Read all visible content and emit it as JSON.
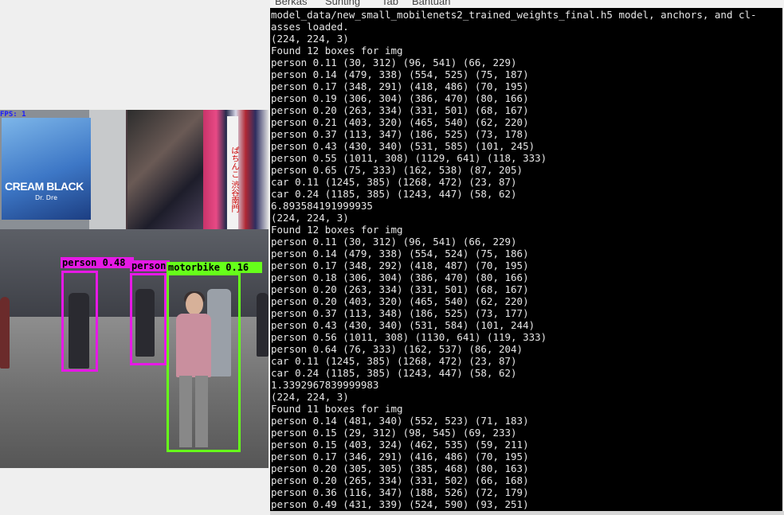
{
  "menubar": {
    "items": [
      "Berkas",
      "Sunting",
      "Tab",
      "Bantuan"
    ]
  },
  "detection_window": {
    "title_tag": "FPS: 1",
    "billboard_text": "CREAM BLACK",
    "billboard_sub": "Dr. Dre",
    "vertical_sign": "ぱちんこ 渋谷南門",
    "boxes": [
      {
        "label": "person 0.48",
        "color": "#e619e6"
      },
      {
        "label": "person",
        "color": "#e619e6"
      },
      {
        "label": "motorbike 0.16",
        "color": "#66ff1a"
      }
    ]
  },
  "terminal": {
    "lines": [
      "model_data/new_small_mobilenets2_trained_weights_final.h5 model, anchors, and cl-",
      "asses loaded.",
      "(224, 224, 3)",
      "Found 12 boxes for img",
      "person 0.11 (30, 312) (96, 541) (66, 229)",
      "person 0.14 (479, 338) (554, 525) (75, 187)",
      "person 0.17 (348, 291) (418, 486) (70, 195)",
      "person 0.19 (306, 304) (386, 470) (80, 166)",
      "person 0.20 (263, 334) (331, 501) (68, 167)",
      "person 0.21 (403, 320) (465, 540) (62, 220)",
      "person 0.37 (113, 347) (186, 525) (73, 178)",
      "person 0.43 (430, 340) (531, 585) (101, 245)",
      "person 0.55 (1011, 308) (1129, 641) (118, 333)",
      "person 0.65 (75, 333) (162, 538) (87, 205)",
      "car 0.11 (1245, 385) (1268, 472) (23, 87)",
      "car 0.24 (1185, 385) (1243, 447) (58, 62)",
      "6.893584191999935",
      "(224, 224, 3)",
      "Found 12 boxes for img",
      "person 0.11 (30, 312) (96, 541) (66, 229)",
      "person 0.14 (479, 338) (554, 524) (75, 186)",
      "person 0.17 (348, 292) (418, 487) (70, 195)",
      "person 0.18 (306, 304) (386, 470) (80, 166)",
      "person 0.20 (263, 334) (331, 501) (68, 167)",
      "person 0.20 (403, 320) (465, 540) (62, 220)",
      "person 0.37 (113, 348) (186, 525) (73, 177)",
      "person 0.43 (430, 340) (531, 584) (101, 244)",
      "person 0.56 (1011, 308) (1130, 641) (119, 333)",
      "person 0.64 (76, 333) (162, 537) (86, 204)",
      "car 0.11 (1245, 385) (1268, 472) (23, 87)",
      "car 0.24 (1185, 385) (1243, 447) (58, 62)",
      "1.3392967839999983",
      "(224, 224, 3)",
      "Found 11 boxes for img",
      "person 0.14 (481, 340) (552, 523) (71, 183)",
      "person 0.15 (29, 312) (98, 545) (69, 233)",
      "person 0.15 (403, 324) (462, 535) (59, 211)",
      "person 0.17 (346, 291) (416, 486) (70, 195)",
      "person 0.20 (305, 305) (385, 468) (80, 163)",
      "person 0.20 (265, 334) (331, 502) (66, 168)",
      "person 0.36 (116, 347) (188, 526) (72, 179)",
      "person 0.49 (431, 339) (524, 590) (93, 251)"
    ]
  }
}
